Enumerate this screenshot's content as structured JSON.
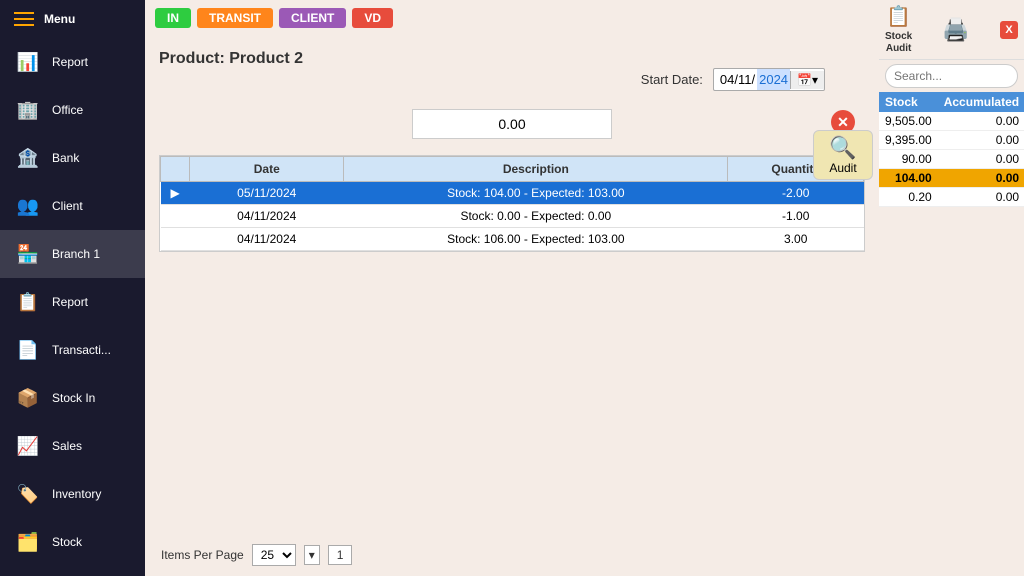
{
  "sidebar": {
    "menu_label": "Menu",
    "items": [
      {
        "id": "report",
        "label": "Report",
        "icon": "📊"
      },
      {
        "id": "office",
        "label": "Office",
        "icon": "🏢"
      },
      {
        "id": "bank",
        "label": "Bank",
        "icon": "🏦"
      },
      {
        "id": "client",
        "label": "Client",
        "icon": "👥"
      },
      {
        "id": "branch1",
        "label": "Branch 1",
        "icon": "🏪"
      },
      {
        "id": "report2",
        "label": "Report",
        "icon": "📋"
      },
      {
        "id": "transactions",
        "label": "Transacti...",
        "icon": "📄"
      },
      {
        "id": "stock_in",
        "label": "Stock In",
        "icon": "📦"
      },
      {
        "id": "sales",
        "label": "Sales",
        "icon": "📈"
      },
      {
        "id": "inventory",
        "label": "Inventory",
        "icon": "🏷️"
      },
      {
        "id": "stock",
        "label": "Stock",
        "icon": "🗂️"
      }
    ]
  },
  "top_badges": [
    {
      "label": "IN",
      "class": "badge-in"
    },
    {
      "label": "TRANSIT",
      "class": "badge-transit"
    },
    {
      "label": "CLIENT",
      "class": "badge-client"
    },
    {
      "label": "VD",
      "class": "badge-vd"
    }
  ],
  "stock_audit": {
    "title": "Stock\nAudit",
    "search_placeholder": "Search...",
    "table_headers": [
      "Stock",
      "Accumulated"
    ],
    "rows": [
      {
        "stock": "9,505.00",
        "accumulated": "0.00",
        "highlighted": false
      },
      {
        "stock": "9,395.00",
        "accumulated": "0.00",
        "highlighted": false
      },
      {
        "stock": "90.00",
        "accumulated": "0.00",
        "highlighted": false
      },
      {
        "stock": "104.00",
        "accumulated": "0.00",
        "highlighted": true
      },
      {
        "stock": "0.20",
        "accumulated": "0.00",
        "highlighted": false
      }
    ]
  },
  "product": {
    "title": "Product: Product 2",
    "start_date_label": "Start Date:",
    "date_value": "04/11/",
    "date_selected": "2024",
    "stock_value": "0.00",
    "close_icon": "✕",
    "audit_label": "Audit"
  },
  "data_table": {
    "headers": [
      "Date",
      "Description",
      "Quantity"
    ],
    "rows": [
      {
        "arrow": "▶",
        "date": "05/11/2024",
        "description": "Stock: 104.00 - Expected: 103.00",
        "quantity": "-2.00",
        "selected": true
      },
      {
        "arrow": "",
        "date": "04/11/2024",
        "description": "Stock: 0.00 - Expected: 0.00",
        "quantity": "-1.00",
        "selected": false
      },
      {
        "arrow": "",
        "date": "04/11/2024",
        "description": "Stock: 106.00 - Expected: 103.00",
        "quantity": "3.00",
        "selected": false
      }
    ]
  },
  "pagination": {
    "items_per_page_label": "Items Per Page",
    "per_page_value": "25",
    "page_number": "1"
  }
}
